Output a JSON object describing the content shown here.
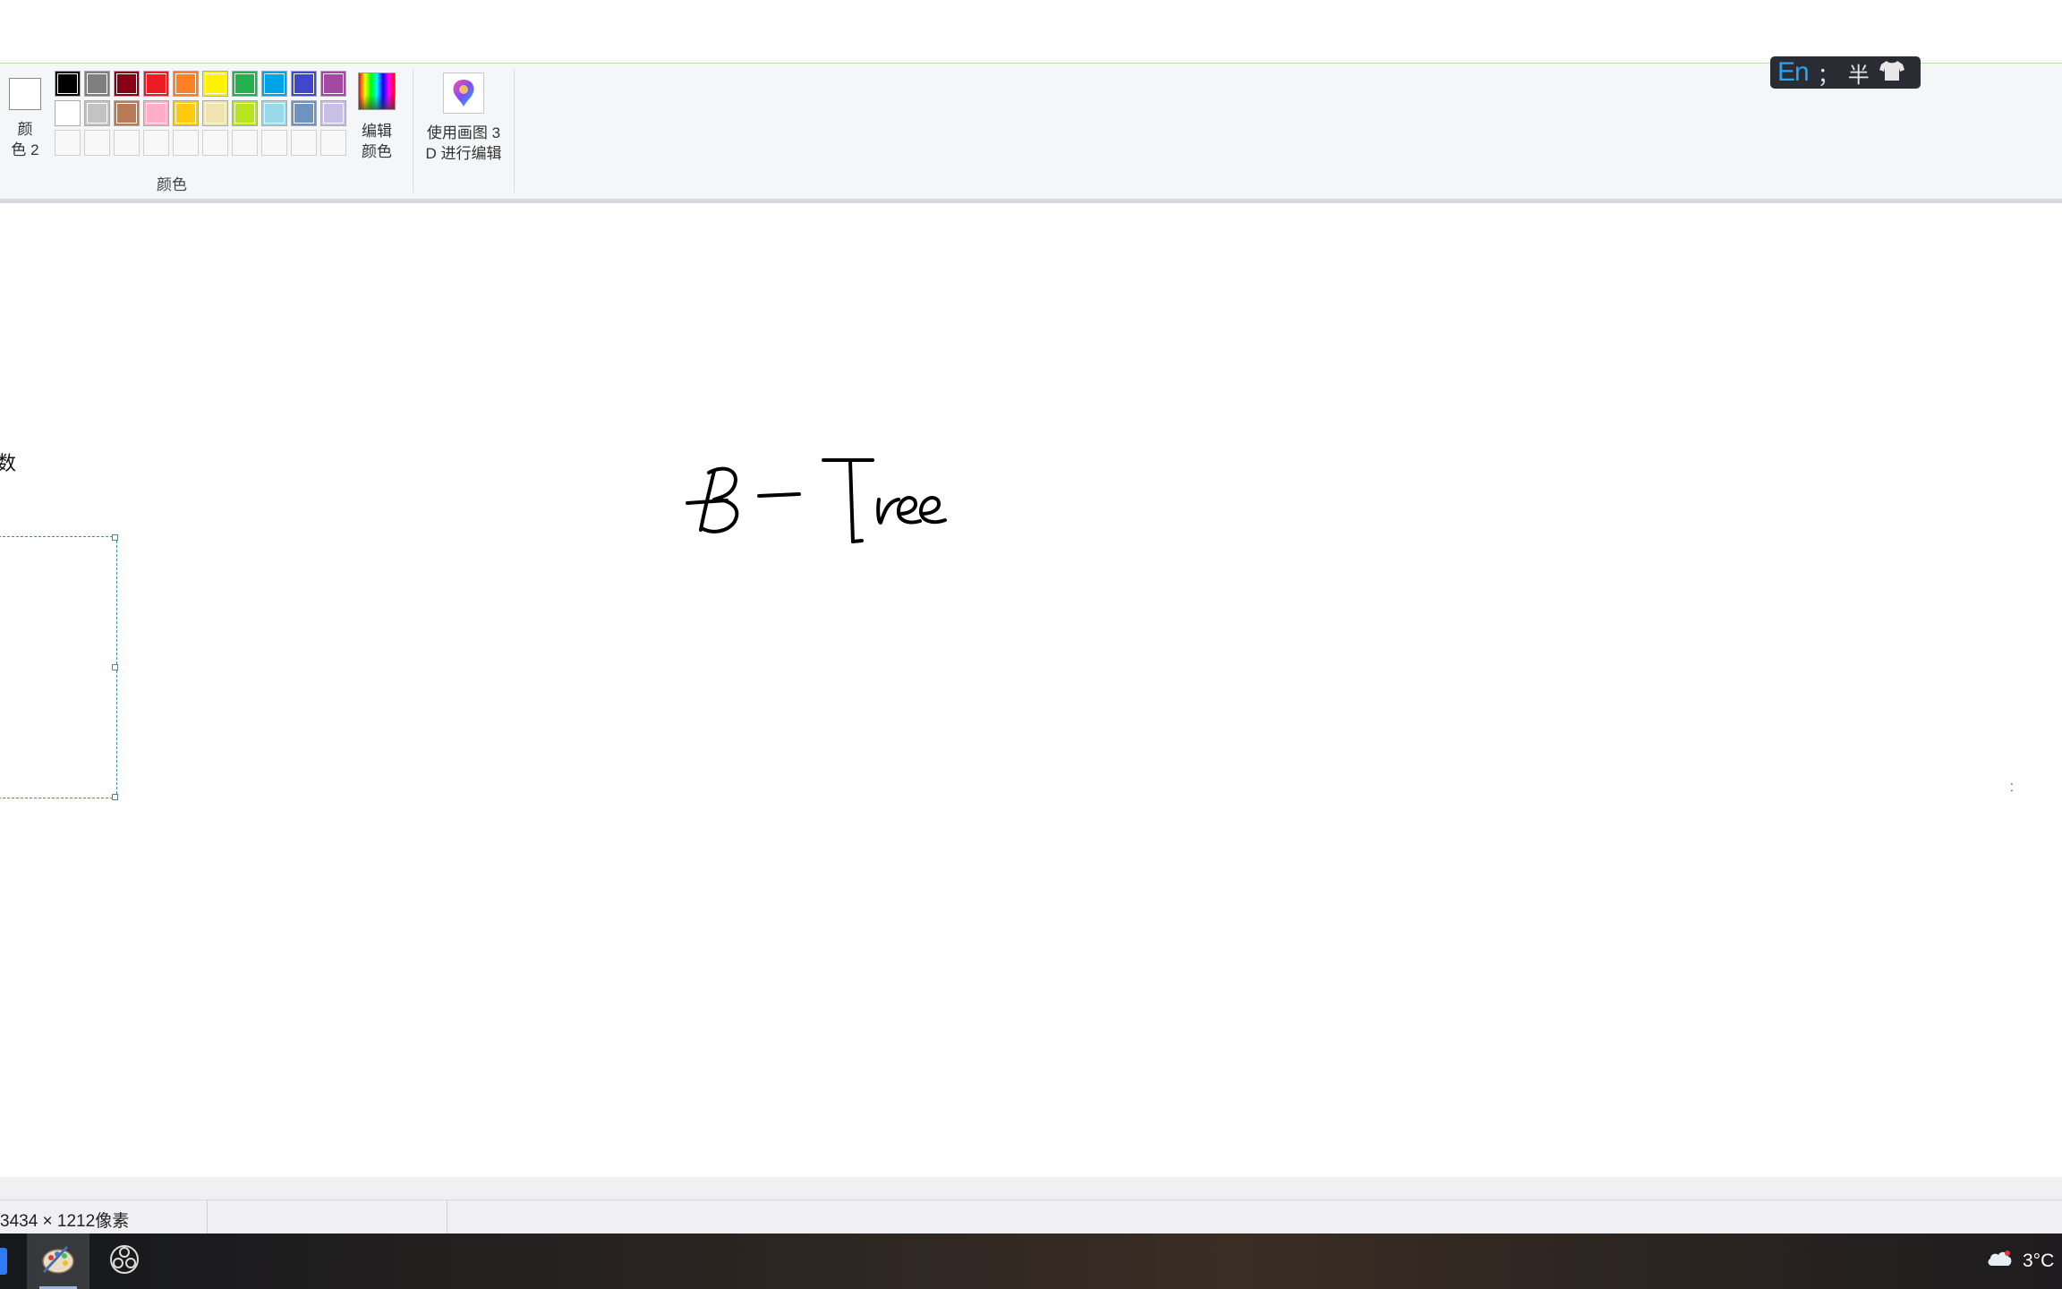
{
  "ribbon": {
    "color2_label": "颜\n色 2",
    "color2_line1": "颜",
    "color2_line2": "色 2",
    "edit_colors_line1": "编辑",
    "edit_colors_line2": "颜色",
    "group_label": "颜色",
    "paint3d_line1": "使用画图 3",
    "paint3d_line2": "D 进行编辑",
    "palette": [
      [
        "#000000",
        "#7f7f7f",
        "#880015",
        "#ed1c24",
        "#ff7f27",
        "#fff200",
        "#22b14c",
        "#00a2e8",
        "#3f48cc",
        "#a349a4"
      ],
      [
        "#ffffff",
        "#c3c3c3",
        "#b97a57",
        "#ffaec9",
        "#ffc90e",
        "#efe4b0",
        "#b5e61d",
        "#99d9ea",
        "#7092be",
        "#c8bfe7"
      ]
    ],
    "custom_slots": 10
  },
  "ime": {
    "lang": "En",
    "punct": "；",
    "width": "半",
    "skin_icon": "shirt-icon"
  },
  "canvas": {
    "handwriting": "B - Tree",
    "selection_text": "数"
  },
  "status": {
    "dimensions": "3434 × 1212像素"
  },
  "taskbar": {
    "apps": [
      "paint-icon",
      "obs-icon"
    ],
    "weather_icon": "cloud-icon",
    "temperature": "3°C"
  }
}
